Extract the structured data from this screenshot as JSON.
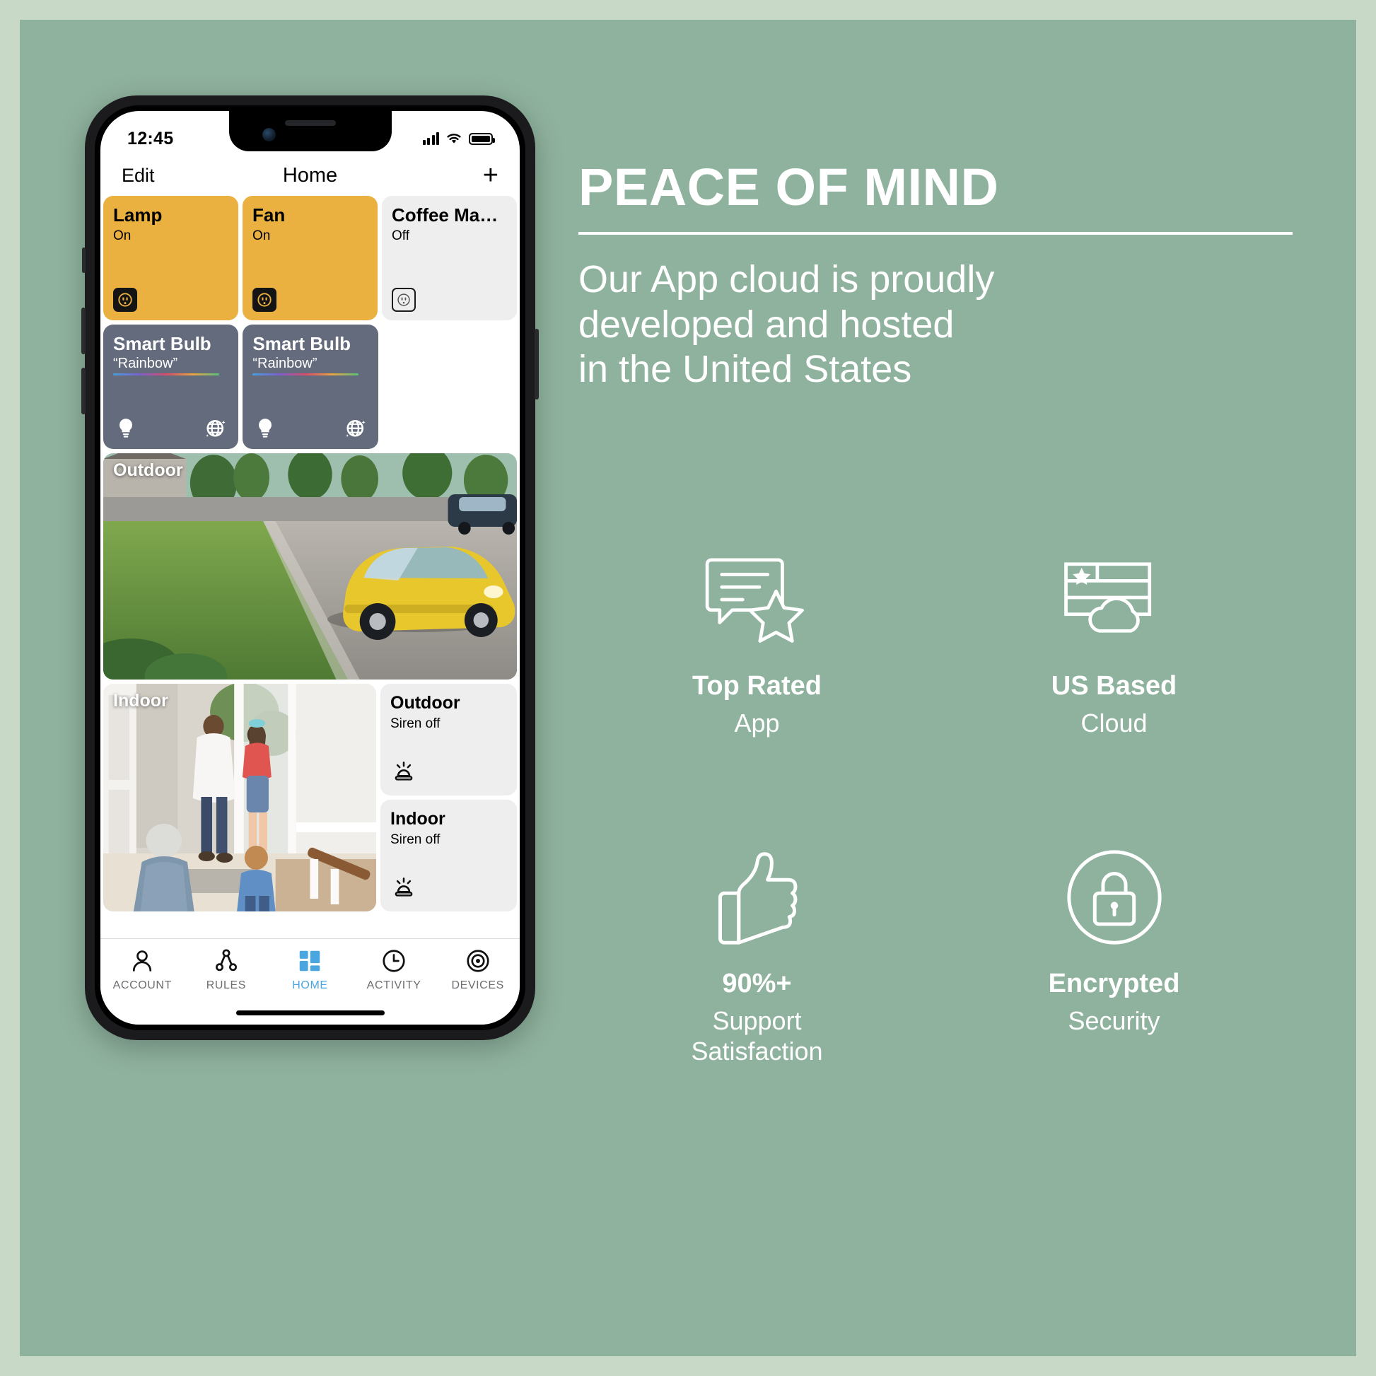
{
  "colors": {
    "page_background": "#c8d9c8",
    "panel_background": "#8fb29e",
    "tile_on": "#eab040",
    "tile_off": "#eeeeef",
    "tile_bulb": "#636b7d",
    "accent_active_tab": "#4aa6e0",
    "text_on_panel": "#ffffff"
  },
  "phone": {
    "statusbar": {
      "clock": "12:45",
      "signal_icon": "cellular-signal-icon",
      "wifi_icon": "wifi-icon",
      "battery_icon": "battery-full-icon"
    },
    "header": {
      "edit_label": "Edit",
      "title": "Home",
      "add_label": "+"
    },
    "tiles": [
      {
        "name": "Lamp",
        "state": "On",
        "type": "outlet",
        "style": "on",
        "icon": "outlet-icon"
      },
      {
        "name": "Fan",
        "state": "On",
        "type": "outlet",
        "style": "on",
        "icon": "outlet-icon"
      },
      {
        "name": "Coffee Ma…",
        "state": "Off",
        "type": "outlet",
        "style": "off",
        "icon": "outlet-icon"
      },
      {
        "name": "Smart Bulb",
        "state": "“Rainbow”",
        "type": "bulb",
        "style": "bulb",
        "icon": "lightbulb-icon",
        "icon2": "disco-globe-icon"
      },
      {
        "name": "Smart Bulb",
        "state": "“Rainbow”",
        "type": "bulb",
        "style": "bulb",
        "icon": "lightbulb-icon",
        "icon2": "disco-globe-icon"
      }
    ],
    "cameras": [
      {
        "label": "Outdoor",
        "scene": "driveway-with-yellow-car"
      },
      {
        "label": "Indoor",
        "scene": "front-door-family-entry"
      }
    ],
    "sirens": [
      {
        "name": "Outdoor",
        "state": "Siren off",
        "icon": "siren-icon"
      },
      {
        "name": "Indoor",
        "state": "Siren off",
        "icon": "siren-icon"
      }
    ],
    "tabs": [
      {
        "label": "ACCOUNT",
        "icon": "person-icon",
        "active": false
      },
      {
        "label": "RULES",
        "icon": "rules-node-icon",
        "active": false
      },
      {
        "label": "HOME",
        "icon": "home-grid-icon",
        "active": true
      },
      {
        "label": "ACTIVITY",
        "icon": "clock-icon",
        "active": false
      },
      {
        "label": "DEVICES",
        "icon": "devices-target-icon",
        "active": false
      }
    ]
  },
  "marketing": {
    "headline": "PEACE OF MIND",
    "subheadline_lines": [
      "Our App cloud is proudly",
      "developed and hosted",
      "in the United States"
    ],
    "features": [
      {
        "icon": "review-star-icon",
        "title": "Top Rated",
        "subtitle": "App"
      },
      {
        "icon": "us-flag-cloud-icon",
        "title": "US Based",
        "subtitle": "Cloud"
      },
      {
        "icon": "thumbs-up-icon",
        "title": "90%+",
        "subtitle": "Support\nSatisfaction"
      },
      {
        "icon": "lock-circle-icon",
        "title": "Encrypted",
        "subtitle": "Security"
      }
    ]
  }
}
